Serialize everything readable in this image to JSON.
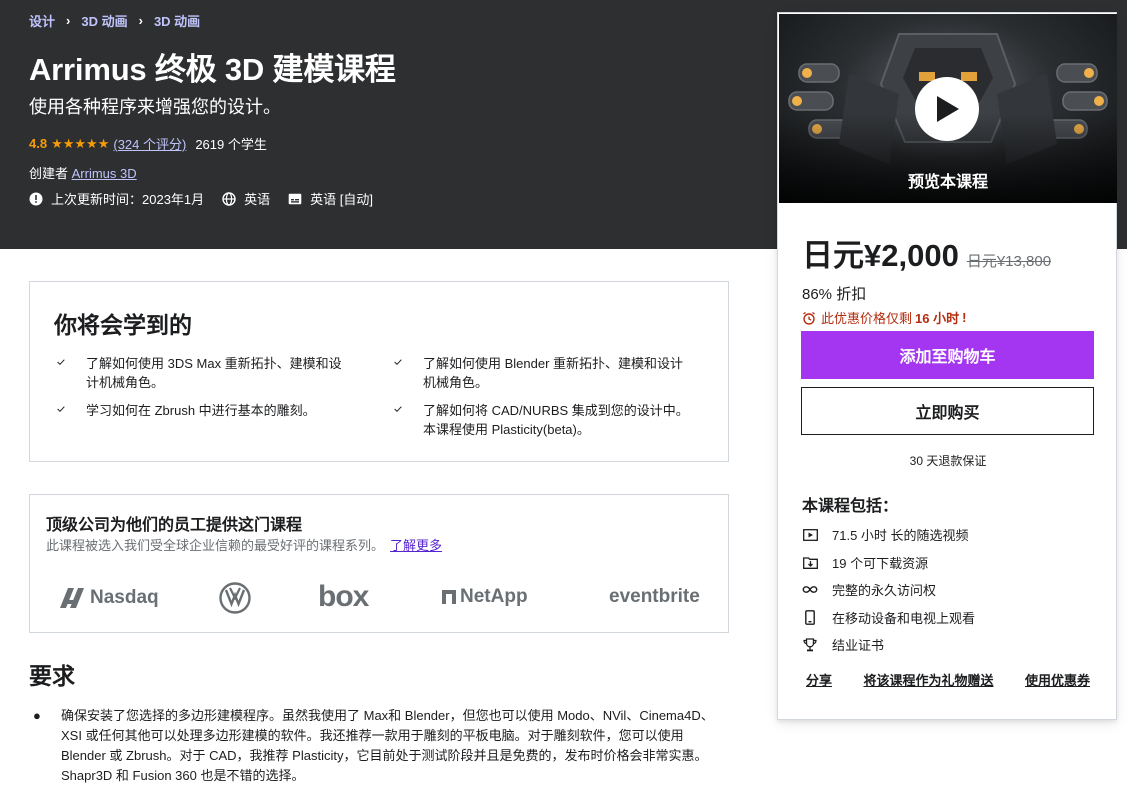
{
  "breadcrumb": [
    "设计",
    "3D 动画",
    "3D 动画"
  ],
  "course": {
    "title": "Arrimus 终极 3D 建模课程",
    "subtitle": "使用各种程序来增强您的设计。",
    "rating": "4.8",
    "stars": "★★★★★",
    "rating_count": "(324 个评分)",
    "students": "2619 个学生",
    "creator_label": "创建者",
    "creator_name": "Arrimus 3D",
    "updated": "上次更新时间：2023年1月",
    "language": "英语",
    "captions": "英语 [自动]"
  },
  "sidebar": {
    "preview_label": "预览本课程",
    "price": "日元¥2,000",
    "original_price": "日元¥13,800",
    "discount": "86% 折扣",
    "urgency_prefix": "此优惠价格仅剩",
    "urgency_time": "16 小时",
    "urgency_suffix": "!",
    "add_to_cart": "添加至购物车",
    "buy_now": "立即购买",
    "guarantee": "30 天退款保证",
    "includes_title": "本课程包括：",
    "includes": [
      {
        "icon": "video-icon",
        "text": "71.5 小时 长的随选视频"
      },
      {
        "icon": "download-icon",
        "text": "19 个可下载资源"
      },
      {
        "icon": "infinity-icon",
        "text": "完整的永久访问权"
      },
      {
        "icon": "mobile-icon",
        "text": "在移动设备和电视上观看"
      },
      {
        "icon": "trophy-icon",
        "text": "结业证书"
      }
    ],
    "links": [
      "分享",
      "将该课程作为礼物赠送",
      "使用优惠券"
    ]
  },
  "learn": {
    "title": "你将会学到的",
    "items": [
      "了解如何使用 3DS Max 重新拓扑、建模和设计机械角色。",
      "了解如何使用 Blender 重新拓扑、建模和设计机械角色。",
      "学习如何在 Zbrush 中进行基本的雕刻。",
      "了解如何将 CAD/NURBS 集成到您的设计中。本课程使用 Plasticity(beta)。"
    ]
  },
  "business": {
    "title": "顶级公司为他们的员工提供这门课程",
    "description": "此课程被选入我们受全球企业信赖的最受好评的课程系列。",
    "learn_more": "了解更多",
    "logos": [
      "Nasdaq",
      "box",
      "NetApp",
      "eventbrite"
    ]
  },
  "requirements": {
    "title": "要求",
    "items": [
      "确保安装了您选择的多边形建模程序。虽然我使用了 Max和 Blender，但您也可以使用 Modo、NVil、Cinema4D、XSI 或任何其他可以处理多边形建模的软件。我还推荐一款用于雕刻的平板电脑。对于雕刻软件，您可以使用 Blender 或 Zbrush。对于 CAD，我推荐 Plasticity，它目前处于测试阶段并且是免费的，发布时价格会非常实惠。Shapr3D 和 Fusion 360 也是不错的选择。"
    ]
  },
  "colors": {
    "hero_bg": "#2d2f31",
    "accent_purple": "#a435f0",
    "link_purple": "#c0c4fc",
    "star": "#f69c08",
    "urgency": "#b32d0f"
  }
}
